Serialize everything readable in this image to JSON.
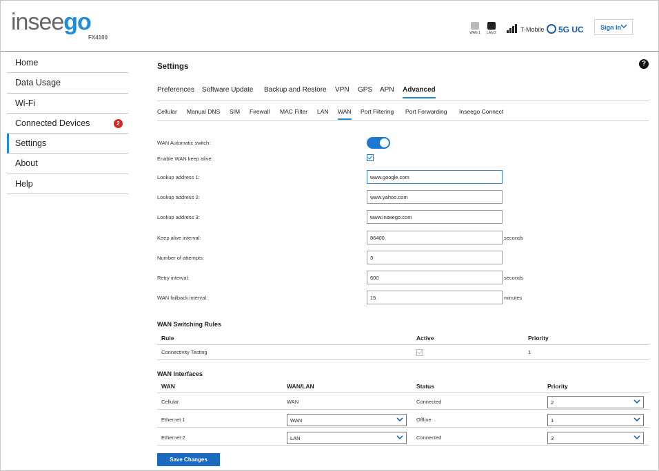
{
  "header": {
    "logo_text_a": "insee",
    "logo_text_b": "go",
    "model": "FX4100",
    "ports": [
      "WAN 1",
      "LAN 2"
    ],
    "carrier": "T-Mobile",
    "network": "5G UC",
    "signin_label": "Sign In"
  },
  "sidebar": {
    "items": [
      {
        "label": "Home"
      },
      {
        "label": "Data Usage"
      },
      {
        "label": "Wi-Fi"
      },
      {
        "label": "Connected Devices",
        "badge": "2"
      },
      {
        "label": "Settings"
      },
      {
        "label": "About"
      },
      {
        "label": "Help"
      }
    ],
    "active": "Settings"
  },
  "page": {
    "title": "Settings",
    "help": "?"
  },
  "tabs": {
    "primary": [
      "Preferences",
      "Software Update",
      "Backup and Restore",
      "VPN",
      "GPS",
      "APN",
      "Advanced"
    ],
    "primary_active": "Advanced",
    "secondary": [
      "Cellular",
      "Manual DNS",
      "SIM",
      "Firewall",
      "MAC Filter",
      "LAN",
      "WAN",
      "Port Filtering",
      "Port Forwarding",
      "Inseego Connect"
    ],
    "secondary_active": "WAN"
  },
  "form": {
    "wan_auto_switch_label": "WAN Automatic switch:",
    "wan_auto_switch_on": true,
    "keep_alive_label": "Enable WAN keep alive:",
    "keep_alive_checked": true,
    "lookup1_label": "Lookup address 1:",
    "lookup1_value": "www.google.com",
    "lookup2_label": "Lookup address 2:",
    "lookup2_value": "www.yahoo.com",
    "lookup3_label": "Lookup address 3:",
    "lookup3_value": "www.inseego.com",
    "keep_alive_interval_label": "Keep alive interval:",
    "keep_alive_interval_value": "86400",
    "keep_alive_interval_unit": "seconds",
    "attempts_label": "Number of attempts:",
    "attempts_value": "3",
    "retry_label": "Retry interval:",
    "retry_value": "600",
    "retry_unit": "seconds",
    "failback_label": "WAN failback interval:",
    "failback_value": "15",
    "failback_unit": "minutes"
  },
  "switching_rules": {
    "title": "WAN Switching Rules",
    "headers": {
      "rule": "Rule",
      "active": "Active",
      "priority": "Priority"
    },
    "rows": [
      {
        "rule": "Connectivity Testing",
        "active": true,
        "priority": "1"
      }
    ]
  },
  "interfaces": {
    "title": "WAN Interfaces",
    "headers": {
      "wan": "WAN",
      "wanlan": "WAN/LAN",
      "status": "Status",
      "priority": "Priority"
    },
    "rows": [
      {
        "wan": "Cellular",
        "wanlan": "WAN",
        "status": "Connected",
        "priority": "2"
      },
      {
        "wan": "Ethernet 1",
        "wanlan": "WAN",
        "status": "Offline",
        "priority": "1"
      },
      {
        "wan": "Ethernet 2",
        "wanlan": "LAN",
        "status": "Connected",
        "priority": "3"
      }
    ]
  },
  "actions": {
    "save_label": "Save Changes"
  },
  "colors": {
    "accent": "#1f8dd6",
    "button": "#1a6bbf",
    "badge": "#e02020"
  }
}
